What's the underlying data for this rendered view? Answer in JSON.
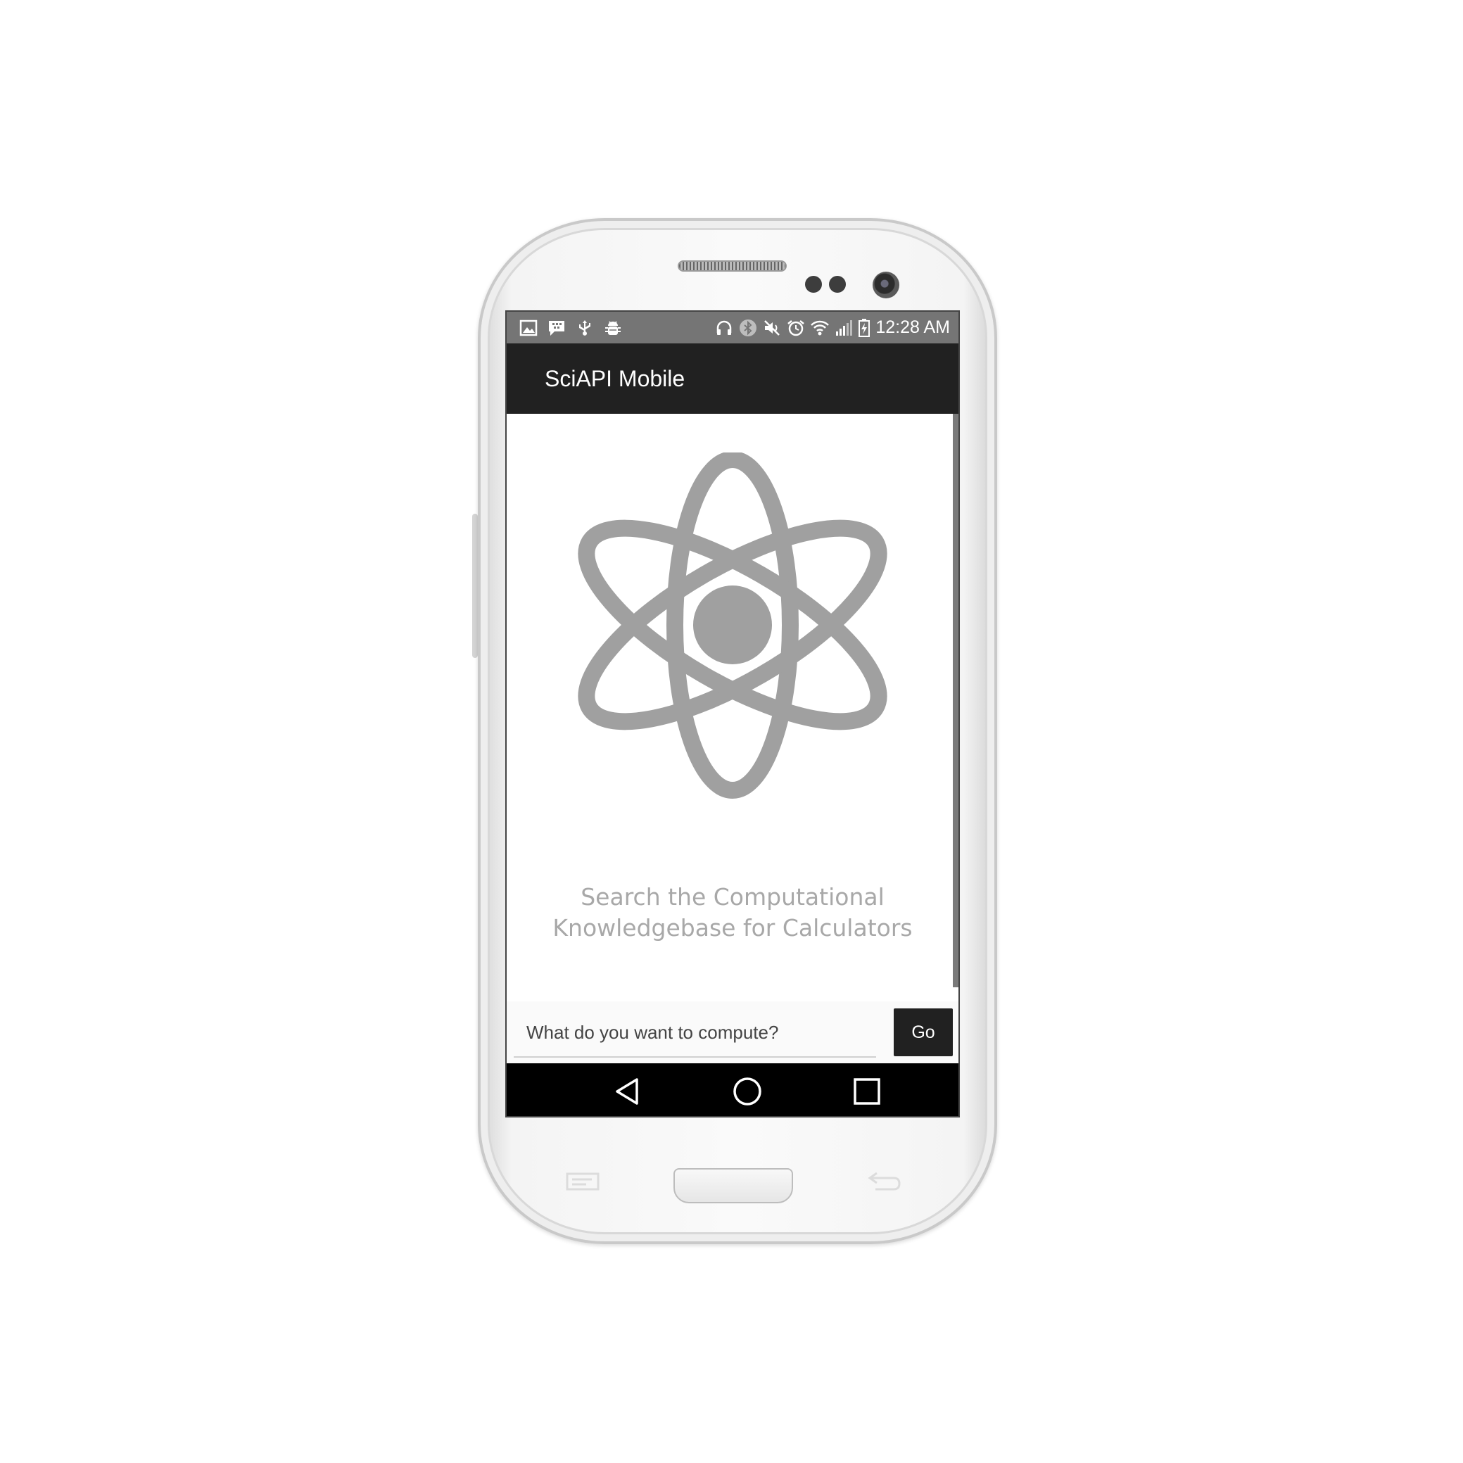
{
  "status_bar": {
    "time": "12:28 AM",
    "left_icons": [
      "image-icon",
      "bbm-chat-icon",
      "usb-icon",
      "android-debug-icon"
    ],
    "right_icons": [
      "headphones-icon",
      "bluetooth-icon",
      "mute-icon",
      "alarm-icon",
      "wifi-icon",
      "signal-icon",
      "battery-charging-icon"
    ]
  },
  "app_bar": {
    "title": "SciAPI Mobile"
  },
  "main": {
    "logo_icon": "atom-icon",
    "tagline_line1": "Search the Computational",
    "tagline_line2": "Knowledgebase for Calculators"
  },
  "query": {
    "placeholder": "What do you want to compute?",
    "value": "",
    "go_label": "Go"
  },
  "nav_bar": {
    "buttons": [
      "back-icon",
      "home-icon",
      "recents-icon"
    ]
  },
  "colors": {
    "status_bar": "#757575",
    "app_bar": "#212121",
    "logo": "#a0a0a0",
    "tagline": "#a8a8a8",
    "go_button": "#212121",
    "nav_bar": "#000000"
  }
}
